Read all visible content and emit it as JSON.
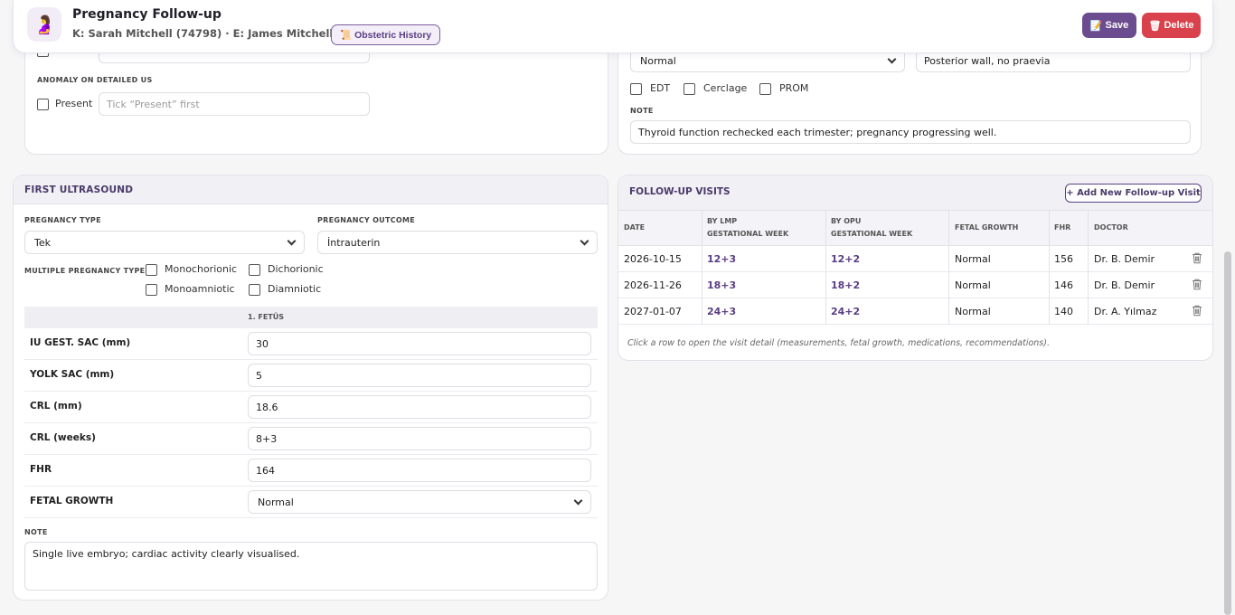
{
  "header": {
    "title": "Pregnancy Follow-up",
    "subtitle": "K: Sarah Mitchell (74798) · E: James Mitchell (74799)",
    "history_button": "Obstetric History",
    "save_label": "Save",
    "delete_label": "Delete"
  },
  "top_left": {
    "anomaly_label": "ANOMALY ON DETAILED US",
    "present_label": "Present",
    "anomaly_placeholder": "Tick “Present” first"
  },
  "top_right": {
    "placenta_select": "Normal",
    "placenta_location": "Posterior wall, no praevia",
    "checkboxes": [
      "EDT",
      "Cerclage",
      "PROM"
    ],
    "note_label": "NOTE",
    "note_value": "Thyroid function rechecked each trimester; pregnancy progressing well."
  },
  "first_us": {
    "title": "FIRST ULTRASOUND",
    "pregnancy_type_label": "PREGNANCY TYPE",
    "pregnancy_type_value": "Tek",
    "outcome_label": "PREGNANCY OUTCOME",
    "outcome_value": "İntrauterin",
    "multiple_label": "MULTIPLE PREGNANCY TYPE",
    "multiple_options": [
      "Monochorionic",
      "Dichorionic",
      "Monoamniotic",
      "Diamniotic"
    ],
    "fetus_col": "1. FETÜS",
    "rows": [
      {
        "label": "IU GEST. SAC (mm)",
        "value": "30"
      },
      {
        "label": "YOLK SAC (mm)",
        "value": "5"
      },
      {
        "label": "CRL (mm)",
        "value": "18.6"
      },
      {
        "label": "CRL (weeks)",
        "value": "8+3"
      },
      {
        "label": "FHR",
        "value": "164"
      },
      {
        "label": "FETAL GROWTH",
        "value": "Normal"
      }
    ],
    "note_label": "NOTE",
    "note_value": "Single live embryo; cardiac activity clearly visualised."
  },
  "visits": {
    "title": "FOLLOW-UP VISITS",
    "add_button": "+ Add New Follow-up Visit",
    "headers": {
      "date": "DATE",
      "lmp1": "BY LMP",
      "lmp2": "GESTATIONAL WEEK",
      "opu1": "BY OPU",
      "opu2": "GESTATIONAL WEEK",
      "growth": "FETAL GROWTH",
      "fhr": "FHR",
      "doctor": "DOCTOR"
    },
    "rows": [
      {
        "date": "2026-10-15",
        "lmp": "12+3",
        "opu": "12+2",
        "growth": "Normal",
        "fhr": "156",
        "doctor": "Dr. B. Demir"
      },
      {
        "date": "2026-11-26",
        "lmp": "18+3",
        "opu": "18+2",
        "growth": "Normal",
        "fhr": "146",
        "doctor": "Dr. B. Demir"
      },
      {
        "date": "2027-01-07",
        "lmp": "24+3",
        "opu": "24+2",
        "growth": "Normal",
        "fhr": "140",
        "doctor": "Dr. A. Yılmaz"
      }
    ],
    "hint": "Click a row to open the visit detail (measurements, fetal growth, medications, recommendations)."
  }
}
